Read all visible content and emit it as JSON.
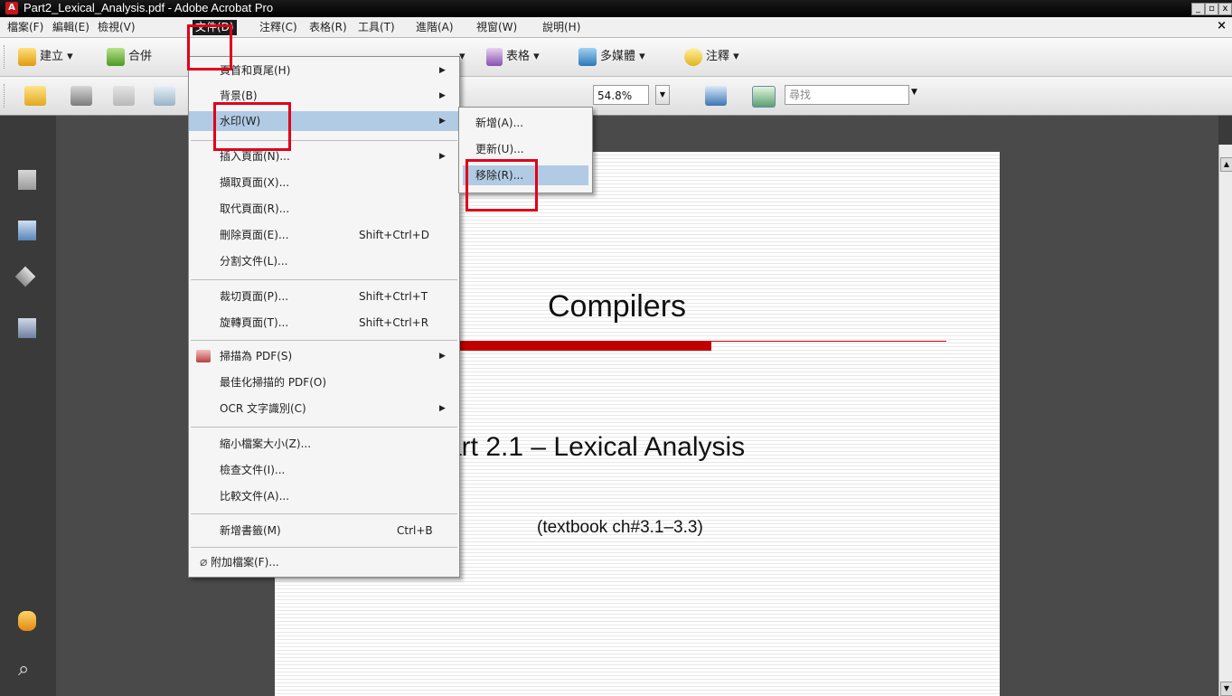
{
  "window": {
    "title": "Part2_Lexical_Analysis.pdf - Adobe Acrobat Pro",
    "app_icon": "pdf-icon",
    "controls": [
      "_",
      "▫",
      "x"
    ]
  },
  "menubar": {
    "items": [
      "檔案(F)",
      "編輯(E)",
      "檢視(V)",
      "文件(D)",
      "注釋(C)",
      "表格(R)",
      "工具(T)",
      "進階(A)",
      "視窗(W)",
      "說明(H)"
    ],
    "active": "文件(D)",
    "close": "×"
  },
  "toolbar1": {
    "create": "建立",
    "combine": "合併",
    "forms": "表格",
    "multimedia": "多媒體",
    "comment": "注釋",
    "dropdown": "▾"
  },
  "toolbar2": {
    "zoom": "54.8%",
    "search_placeholder": "尋找"
  },
  "document_menu": {
    "items": [
      {
        "label": "頁首和頁尾(H)",
        "shortcut": "",
        "submenu": true
      },
      {
        "label": "背景(B)",
        "shortcut": "",
        "submenu": true
      },
      {
        "label": "水印(W)",
        "shortcut": "",
        "submenu": true
      },
      {
        "label": "插入頁面(N)...",
        "shortcut": "",
        "submenu": true
      },
      {
        "label": "擷取頁面(X)...",
        "shortcut": "",
        "submenu": false
      },
      {
        "label": "取代頁面(R)...",
        "shortcut": "",
        "submenu": false
      },
      {
        "label": "刪除頁面(E)...",
        "shortcut": "Shift+Ctrl+D",
        "submenu": false
      },
      {
        "label": "分割文件(L)...",
        "shortcut": "",
        "submenu": false
      },
      {
        "label": "裁切頁面(P)...",
        "shortcut": "Shift+Ctrl+T",
        "submenu": false
      },
      {
        "label": "旋轉頁面(T)...",
        "shortcut": "Shift+Ctrl+R",
        "submenu": false
      },
      {
        "label": "掃描為 PDF(S)",
        "shortcut": "",
        "submenu": true
      },
      {
        "label": "最佳化掃描的 PDF(O)",
        "shortcut": "",
        "submenu": false
      },
      {
        "label": "OCR 文字識別(C)",
        "shortcut": "",
        "submenu": true
      },
      {
        "label": "縮小檔案大小(Z)...",
        "shortcut": "",
        "submenu": false
      },
      {
        "label": "檢查文件(I)...",
        "shortcut": "",
        "submenu": false
      },
      {
        "label": "比較文件(A)...",
        "shortcut": "",
        "submenu": false
      },
      {
        "label": "新增書籤(M)",
        "shortcut": "Ctrl+B",
        "submenu": false
      },
      {
        "label": "附加檔案(F)...",
        "shortcut": "",
        "submenu": false
      }
    ],
    "highlighted": "水印(W)"
  },
  "watermark_submenu": {
    "items": [
      "新增(A)...",
      "更新(U)...",
      "移除(R)..."
    ],
    "highlighted": "移除(R)..."
  },
  "page": {
    "title": "Compilers",
    "subtitle": "art 2.1 – Lexical Analysis",
    "citation": "(textbook ch#3.1–3.3)"
  },
  "colors": {
    "accent_red": "#c00000",
    "highlight_box": "#e0001b",
    "menu_highlight": "#b2cbe4"
  }
}
